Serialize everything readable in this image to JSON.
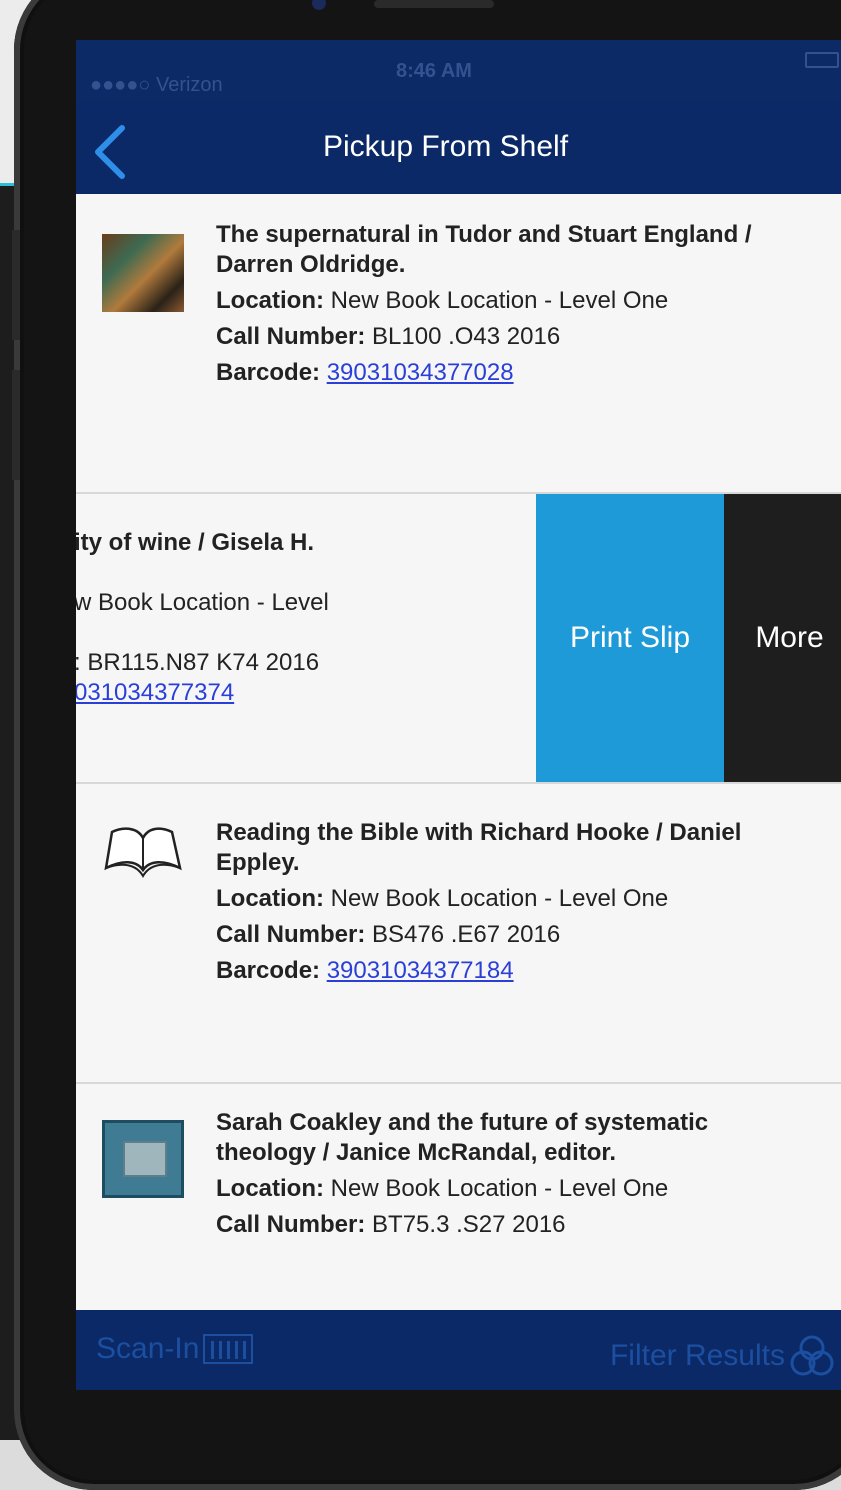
{
  "status_bar": {
    "carrier": "●●●●○ Verizon",
    "time": "8:46 AM"
  },
  "nav": {
    "title": "Pickup From Shelf",
    "back_icon": "chevron-left-icon"
  },
  "items": [
    {
      "title": "The supernatural in Tudor and Stuart England / Darren Oldridge.",
      "location_label": "Location:",
      "location": "New Book Location - Level One",
      "call_number_label": "Call Number:",
      "call_number": "BL100 .O43 2016",
      "barcode_label": "Barcode:",
      "barcode": "39031034377028"
    },
    {
      "title": "ity of wine / Gisela H.",
      "location": "w Book Location - Level",
      "call_number": ": BR115.N87 K74 2016",
      "barcode": "031034377374",
      "actions": {
        "print_slip": "Print Slip",
        "more": "More"
      }
    },
    {
      "title": "Reading the Bible with Richard Hooke / Daniel Eppley.",
      "location_label": "Location:",
      "location": "New Book Location - Level One",
      "call_number_label": "Call Number:",
      "call_number": "BS476 .E67 2016",
      "barcode_label": "Barcode:",
      "barcode": "39031034377184"
    },
    {
      "title": "Sarah Coakley and the future of systematic theology / Janice McRandal, editor.",
      "location_label": "Location:",
      "location": "New Book Location - Level One",
      "call_number_label": "Call Number:",
      "call_number": "BT75.3 .S27 2016"
    }
  ],
  "toolbar": {
    "scan_in": "Scan-In",
    "filter_results": "Filter Results"
  },
  "colors": {
    "nav_background": "#0a2966",
    "print_slip": "#1f9ad9",
    "more": "#1e1e1e",
    "link": "#2a3fd8"
  }
}
